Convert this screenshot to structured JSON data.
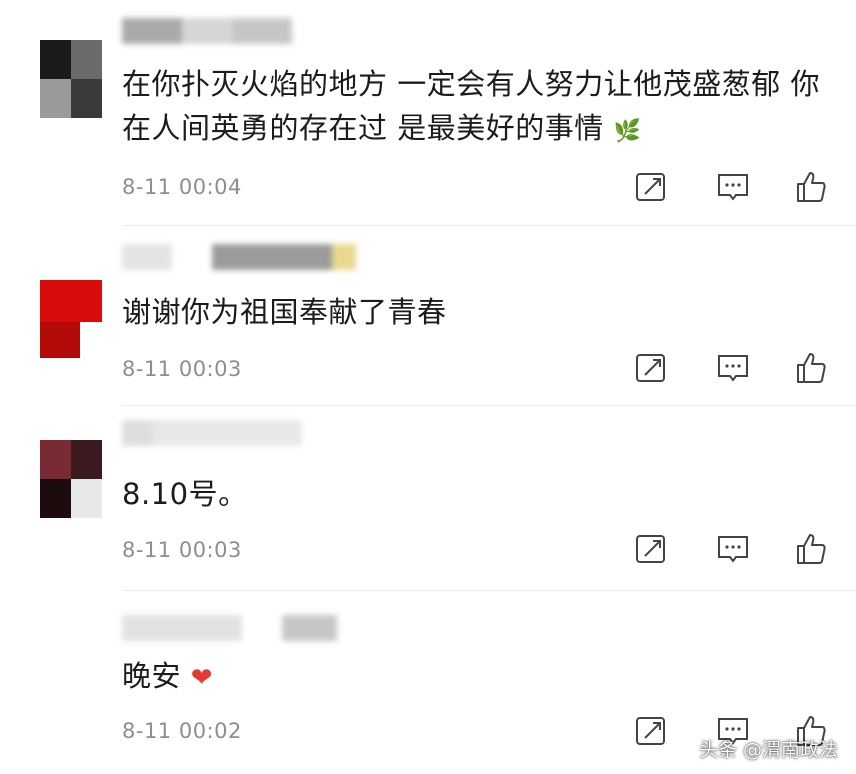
{
  "comments": [
    {
      "text": "在你扑灭火焰的地方 一定会有人努力让他茂盛葱郁 你在人间英勇的存在过 是最美好的事情",
      "emoji": "🌿",
      "time": "8-11 00:04"
    },
    {
      "text": "谢谢你为祖国奉献了青春",
      "time": "8-11 00:03"
    },
    {
      "text": "8.10号。",
      "time": "8-11 00:03"
    },
    {
      "text": "晚安",
      "emoji": "❤",
      "time": "8-11 00:02"
    }
  ],
  "icons": {
    "repost": "repost-icon",
    "comment": "comment-icon",
    "like": "like-icon"
  },
  "watermark": "头条 @渭南政法",
  "colors": {
    "text": "#1c1c1c",
    "time": "#8e8e8e",
    "icon": "#444444",
    "heart": "#e53935"
  }
}
